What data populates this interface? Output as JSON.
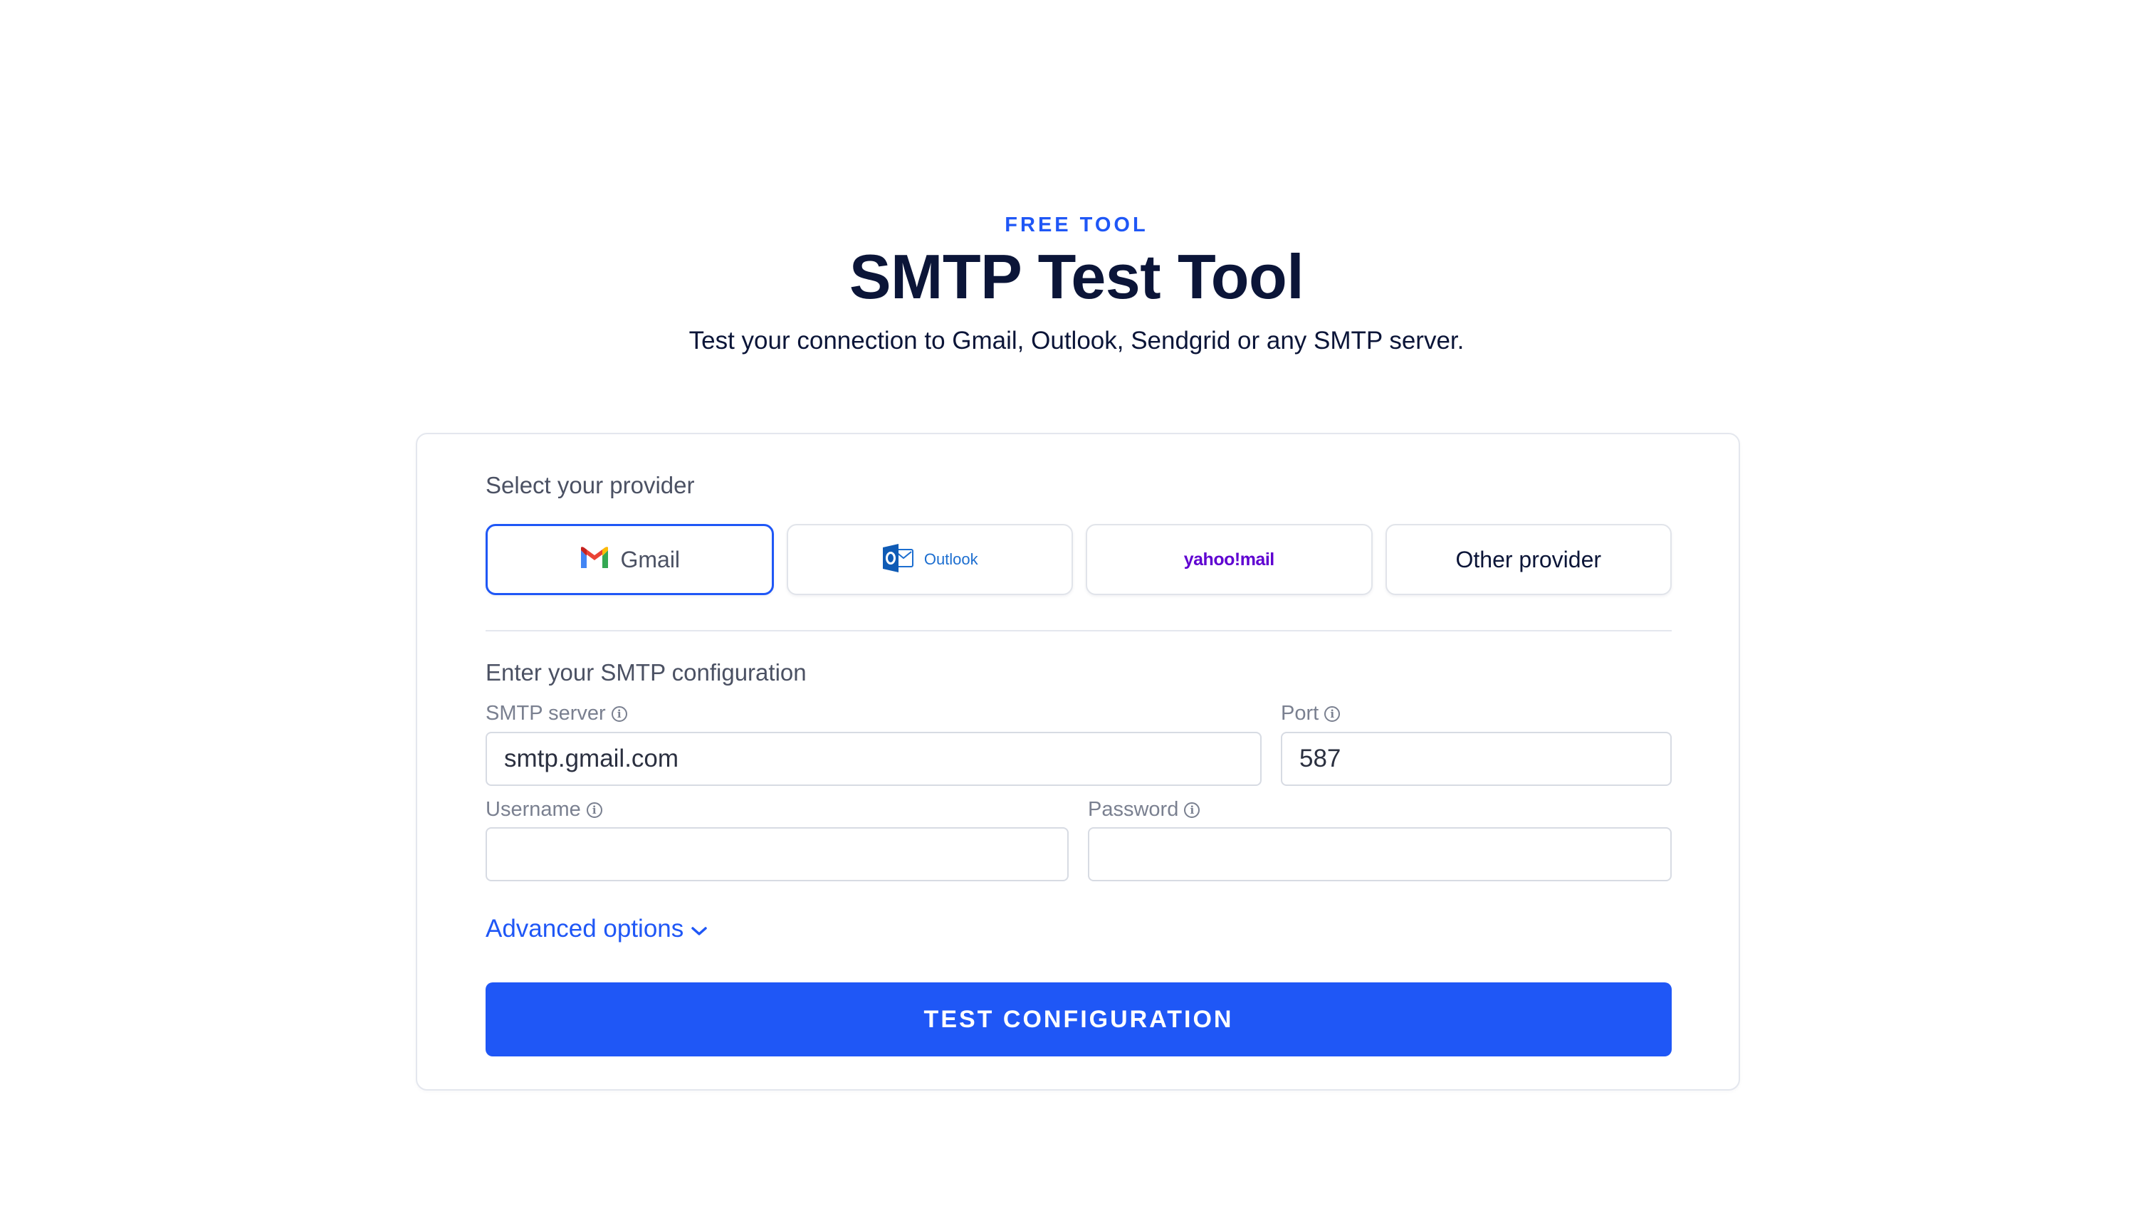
{
  "hero": {
    "eyebrow": "FREE TOOL",
    "title": "SMTP Test Tool",
    "subtitle": "Test your connection to Gmail, Outlook, Sendgrid or any SMTP server."
  },
  "providers": {
    "section_label": "Select your provider",
    "selected": "Gmail",
    "items": [
      {
        "label": "Gmail",
        "icon": "gmail-logo-icon"
      },
      {
        "label": "Outlook",
        "icon": "outlook-logo-icon"
      },
      {
        "label": "yahoo!mail",
        "icon": "yahoo-mail-logo"
      },
      {
        "label": "Other provider",
        "icon": ""
      }
    ]
  },
  "config": {
    "section_label": "Enter your SMTP configuration",
    "smtp_server": {
      "label": "SMTP server",
      "value": "smtp.gmail.com"
    },
    "port": {
      "label": "Port",
      "value": "587"
    },
    "username": {
      "label": "Username",
      "value": ""
    },
    "password": {
      "label": "Password",
      "value": ""
    },
    "info_icon": "i"
  },
  "advanced": {
    "label": "Advanced options",
    "icon": "chevron-down-icon"
  },
  "submit": {
    "label": "TEST CONFIGURATION"
  },
  "colors": {
    "accent": "#1f57f6",
    "heading": "#0b1538",
    "yahoo": "#5f01d1",
    "outlook": "#1c6ed0"
  }
}
